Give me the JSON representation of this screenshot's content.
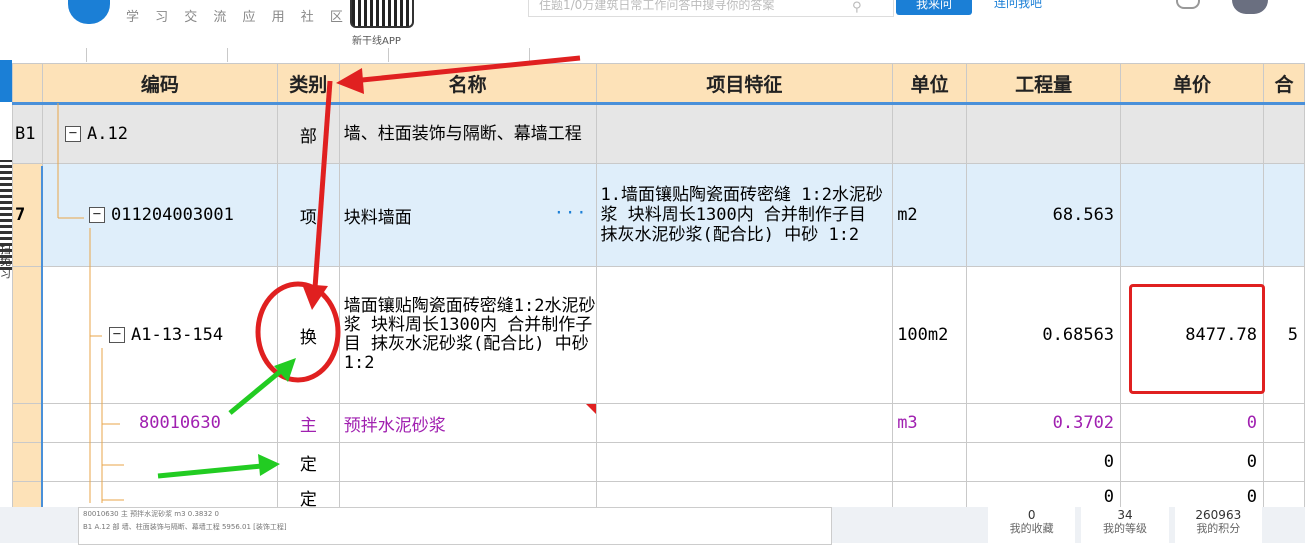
{
  "site": {
    "tagline": "学 习 交 流 应 用 社 区",
    "app_label": "新干线APP",
    "search_placeholder": "住题1/0万建筑日常工作问答中搜寻你的答案",
    "ask_button": "我来问",
    "top_link": "连问我吧"
  },
  "side": {
    "text": "扫免习"
  },
  "stats": [
    {
      "value": "0",
      "label": "我的收藏"
    },
    {
      "value": "34",
      "label": "我的等级"
    },
    {
      "value": "260963",
      "label": "我的积分"
    }
  ],
  "bg_table": {
    "row1": "80010630   主  预拌水泥砂浆           m3   0.3832    0",
    "row2": "B1  A.12       部  墙、柱面装饰与隔断、幕墙工程                                    5956.01 [装饰工程]"
  },
  "columns": [
    "编码",
    "类别",
    "名称",
    "项目特征",
    "单位",
    "工程量",
    "单价",
    "合"
  ],
  "rows": [
    {
      "head": "B1",
      "code": "A.12",
      "type": "部",
      "name": "墙、柱面装饰与隔断、幕墙工程",
      "feature": "",
      "unit": "",
      "qty": "",
      "price": "",
      "total": ""
    },
    {
      "head": "7",
      "code": "011204003001",
      "type": "项",
      "name": "块料墙面",
      "name_extra": "···",
      "feature": "1.墙面镶贴陶瓷面砖密缝 1:2水泥砂浆 块料周长1300内 合并制作子目 抹灰水泥砂浆(配合比) 中砂 1:2",
      "unit": "m2",
      "qty": "68.563",
      "price": "",
      "total": ""
    },
    {
      "head": "",
      "code": "A1-13-154",
      "type": "换",
      "name": "墙面镶贴陶瓷面砖密缝1:2水泥砂浆 块料周长1300内 合并制作子目 抹灰水泥砂浆(配合比) 中砂1:2",
      "feature": "",
      "unit": "100m2",
      "qty": "0.68563",
      "price": "8477.78",
      "total": "5"
    },
    {
      "head": "",
      "code": "80010630",
      "type": "主",
      "name": "预拌水泥砂浆",
      "feature": "",
      "unit": "m3",
      "qty": "0.3702",
      "price": "0",
      "total": ""
    },
    {
      "head": "",
      "code": "",
      "type": "定",
      "name": "",
      "feature": "",
      "unit": "",
      "qty": "0",
      "price": "0",
      "total": ""
    },
    {
      "head": "",
      "code": "",
      "type": "定",
      "name": "",
      "feature": "",
      "unit": "",
      "qty": "0",
      "price": "0",
      "total": ""
    }
  ],
  "colors": {
    "header_bg": "#fde2b8",
    "accent_blue": "#1b7fd6",
    "annot_red": "#e02020",
    "annot_green": "#22cc22",
    "main_row_text": "#a020b0"
  }
}
